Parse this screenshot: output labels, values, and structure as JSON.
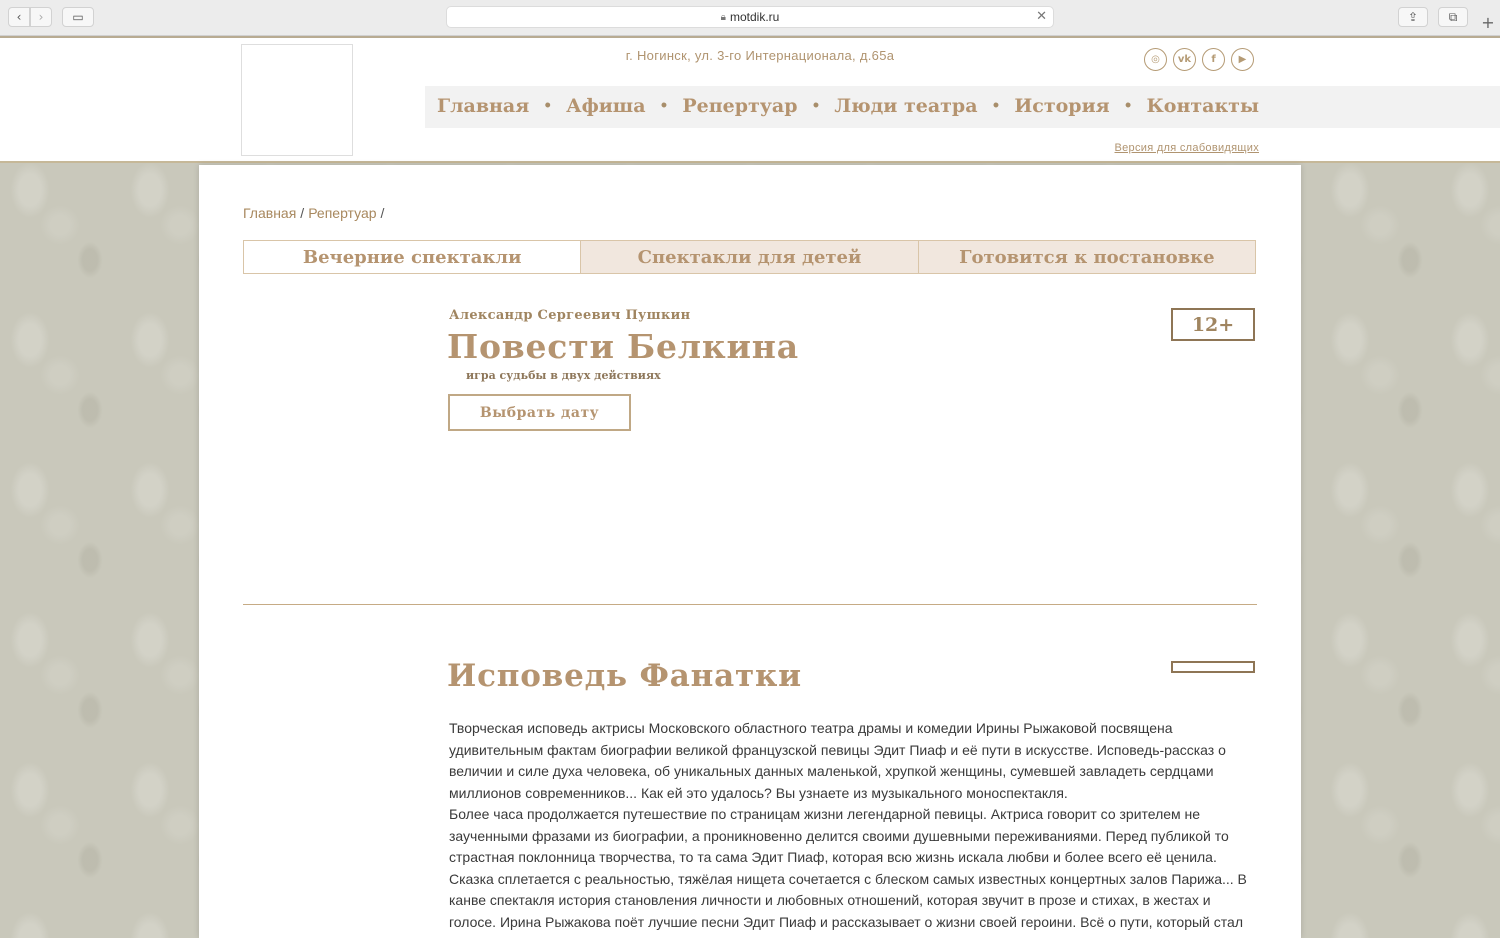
{
  "browser": {
    "url": "motdik.ru"
  },
  "header": {
    "address": "г. Ногинск, ул. 3-го Интернационала, д.65а",
    "socials": [
      {
        "name": "instagram",
        "glyph": "◎"
      },
      {
        "name": "vk",
        "glyph": "vk"
      },
      {
        "name": "facebook",
        "glyph": "f"
      },
      {
        "name": "youtube",
        "glyph": "▶"
      }
    ],
    "nav": [
      "Главная",
      "Афиша",
      "Репертуар",
      "Люди театра",
      "История",
      "Контакты"
    ],
    "nav_separator": "•",
    "low_vision": "Версия для слабовидящих"
  },
  "breadcrumb": {
    "items": [
      "Главная",
      "Репертуар"
    ],
    "separator": "/"
  },
  "tabs": [
    "Вечерние спектакли",
    "Спектакли для детей",
    "Готовится к постановке"
  ],
  "performances": [
    {
      "author": "Александр Сергеевич Пушкин",
      "title": "Повести Белкина",
      "subtitle": "игра судьбы в двух действиях",
      "button": "Выбрать дату",
      "age": "12+"
    },
    {
      "title": "Исповедь Фанатки",
      "age": "",
      "description": [
        "Творческая исповедь актрисы Московского областного театра драмы и комедии Ирины Рыжаковой посвящена удивительным фактам биографии великой французской певицы Эдит Пиаф и её пути в искусстве. Исповедь-рассказ о величии и силе духа человека, об уникальных данных маленькой, хрупкой женщины, сумевшей завладеть сердцами миллионов современников... Как ей это удалось? Вы узнаете из музыкального моноспектакля.",
        "Более часа продолжается путешествие по страницам жизни легендарной певицы. Актриса говорит со зрителем не заученными фразами из биографии, а проникновенно делится своими душевными переживаниями. Перед публикой то страстная поклонница творчества, то та сама Эдит Пиаф, которая всю жизнь искала любви и более всего её ценила.",
        "Сказка сплетается с реальностью, тяжёлая нищета сочетается с блеском самых известных концертных залов Парижа... В канве спектакля история становления личности и любовных отношений, которая звучит в прозе и стихах, в жестах и голосе. Ирина Рыжакова поёт лучшие песни Эдит Пиаф и рассказывает о жизни своей героини. Всё о пути, который стал синонимом"
      ]
    }
  ]
}
